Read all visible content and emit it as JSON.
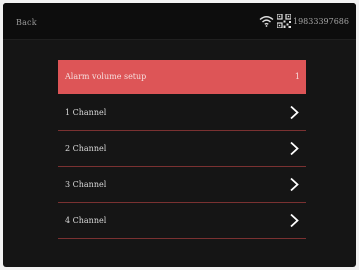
{
  "header": {
    "back_label": "Back",
    "phone_number": "19833397686"
  },
  "menu": {
    "items": [
      {
        "label": "Alarm volume setup",
        "value": "1"
      },
      {
        "label": "1 Channel"
      },
      {
        "label": "2 Channel"
      },
      {
        "label": "3 Channel"
      },
      {
        "label": "4 Channel"
      }
    ]
  },
  "colors": {
    "selected_row": "#dd5557",
    "divider": "#7a3131",
    "background": "#151515"
  },
  "icons": [
    "wifi-icon",
    "qr-code-icon",
    "chevron-right-icon"
  ]
}
